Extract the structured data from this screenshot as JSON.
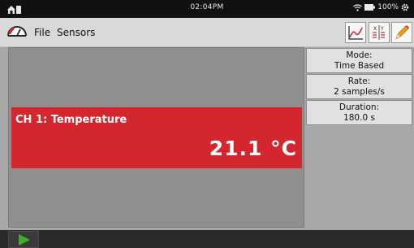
{
  "status_bar": {
    "time": "02:04PM",
    "battery": "100%"
  },
  "menu": {
    "file": "File",
    "sensors": "Sensors"
  },
  "toolbar": {
    "graph_icon": "graph-icon",
    "table_icon": "table-icon",
    "edit_icon": "pencil-icon"
  },
  "channel": {
    "label": "CH 1: Temperature",
    "value": "21.1 °C",
    "color": "#d3262f"
  },
  "settings": {
    "mode_label": "Mode:",
    "mode_value": "Time Based",
    "rate_label": "Rate:",
    "rate_value": "2 samples/s",
    "duration_label": "Duration:",
    "duration_value": "180.0 s"
  },
  "controls": {
    "play_icon": "play-icon",
    "play_color": "#3fae2a"
  }
}
